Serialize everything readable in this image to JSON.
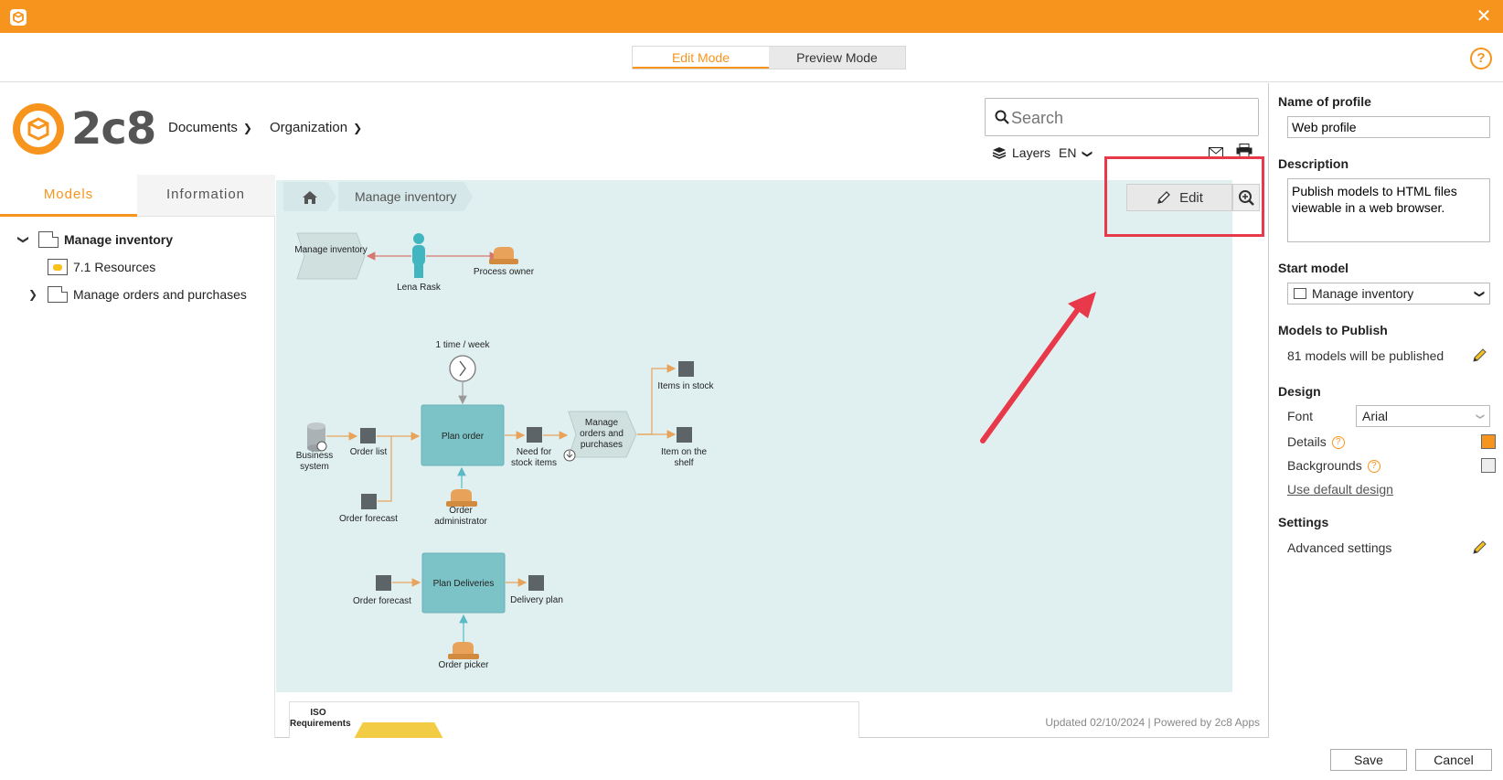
{
  "colors": {
    "accent": "#f7941d",
    "canvas": "#e0f0f1",
    "highlight": "#e8394a"
  },
  "modes": {
    "edit": "Edit Mode",
    "preview": "Preview Mode"
  },
  "header": {
    "logo_text": "2c8",
    "nav": [
      "Documents",
      "Organization"
    ],
    "search_placeholder": "Search",
    "layers": "Layers",
    "language": "EN"
  },
  "left_panel": {
    "tabs": [
      "Models",
      "Information"
    ],
    "tree": [
      {
        "label": "Manage inventory",
        "bold": true
      },
      {
        "label": "7.1 Resources"
      },
      {
        "label": "Manage orders and purchases"
      }
    ]
  },
  "breadcrumb": {
    "current": "Manage inventory"
  },
  "toolbar": {
    "edit": "Edit"
  },
  "diagram": {
    "top_process": "Manage inventory",
    "lena": "Lena Rask",
    "process_owner": "Process owner",
    "frequency": "1 time / week",
    "business_system": "Business system",
    "order_list": "Order list",
    "order_forecast": "Order forecast",
    "plan_order": "Plan order",
    "order_administrator": "Order administrator",
    "need_stock": "Need for stock items",
    "manage_orders": "Manage orders and purchases",
    "items_in_stock": "Items in stock",
    "item_on_shelf": "Item on the shelf",
    "order_forecast_2": "Order forecast",
    "plan_deliveries": "Plan Deliveries",
    "delivery_plan": "Delivery plan",
    "order_picker": "Order picker"
  },
  "footer": {
    "iso": "ISO Requirements",
    "updated": "Updated 02/10/2024 | Powered by 2c8 Apps"
  },
  "right_panel": {
    "name_label": "Name of profile",
    "name_value": "Web profile",
    "description_label": "Description",
    "description_value": "Publish models to HTML files viewable in a web browser.",
    "start_model_label": "Start model",
    "start_model_value": "Manage inventory",
    "models_to_publish_label": "Models to Publish",
    "models_to_publish_value": "81 models will be published",
    "design_label": "Design",
    "font_label": "Font",
    "font_value": "Arial",
    "details_label": "Details",
    "backgrounds_label": "Backgrounds",
    "default_design_link": "Use default design",
    "settings_label": "Settings",
    "advanced_settings": "Advanced settings"
  },
  "buttons": {
    "save": "Save",
    "cancel": "Cancel"
  }
}
